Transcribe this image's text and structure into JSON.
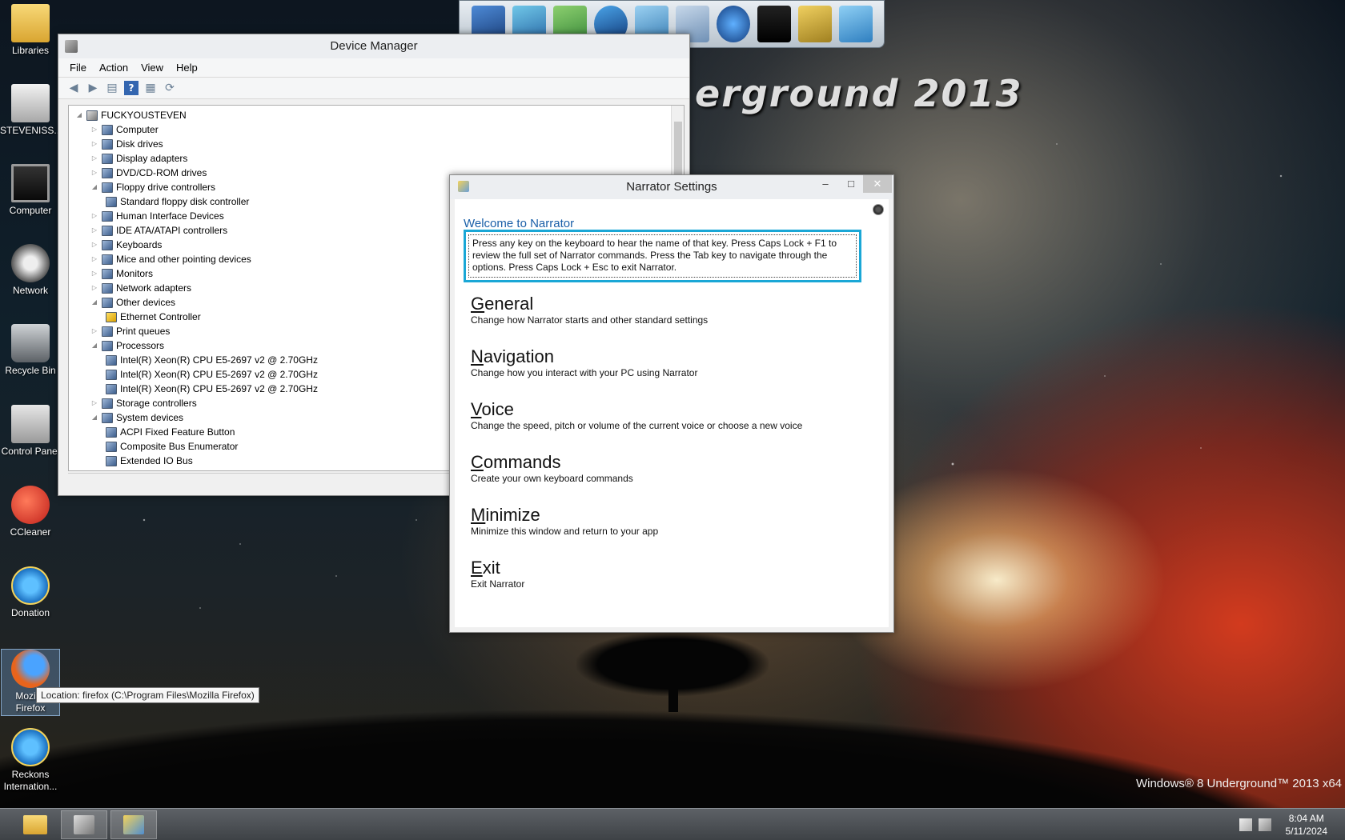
{
  "wallpaper": {
    "title": "erground 2013",
    "watermark": "Windows® 8 Underground™ 2013 x64"
  },
  "desktop_icons": [
    {
      "label": "Libraries",
      "icon": "folder-icon"
    },
    {
      "label": "STEVENISS...",
      "icon": "drive-icon"
    },
    {
      "label": "Computer",
      "icon": "monitor-icon"
    },
    {
      "label": "Network",
      "icon": "network-icon"
    },
    {
      "label": "Recycle Bin",
      "icon": "recycle-bin-icon"
    },
    {
      "label": "Control Panel",
      "icon": "control-panel-icon"
    },
    {
      "label": "CCleaner",
      "icon": "ccleaner-icon"
    },
    {
      "label": "Donation",
      "icon": "internet-explorer-icon"
    },
    {
      "label": "Mozilla Firefox",
      "icon": "firefox-icon"
    },
    {
      "label": "Reckons Internation...",
      "icon": "internet-explorer-icon"
    }
  ],
  "firefox_tooltip": "Location: firefox (C:\\Program Files\\Mozilla Firefox)",
  "device_manager": {
    "title": "Device Manager",
    "menu": [
      "File",
      "Action",
      "View",
      "Help"
    ],
    "tree": [
      {
        "label": "FUCKYOUSTEVEN",
        "level": 0,
        "expanded": true
      },
      {
        "label": "Computer",
        "level": 1,
        "expanded": false
      },
      {
        "label": "Disk drives",
        "level": 1,
        "expanded": false
      },
      {
        "label": "Display adapters",
        "level": 1,
        "expanded": false
      },
      {
        "label": "DVD/CD-ROM drives",
        "level": 1,
        "expanded": false
      },
      {
        "label": "Floppy drive controllers",
        "level": 1,
        "expanded": true
      },
      {
        "label": "Standard floppy disk controller",
        "level": 2
      },
      {
        "label": "Human Interface Devices",
        "level": 1,
        "expanded": false
      },
      {
        "label": "IDE ATA/ATAPI controllers",
        "level": 1,
        "expanded": false
      },
      {
        "label": "Keyboards",
        "level": 1,
        "expanded": false
      },
      {
        "label": "Mice and other pointing devices",
        "level": 1,
        "expanded": false
      },
      {
        "label": "Monitors",
        "level": 1,
        "expanded": false
      },
      {
        "label": "Network adapters",
        "level": 1,
        "expanded": false
      },
      {
        "label": "Other devices",
        "level": 1,
        "expanded": true
      },
      {
        "label": "Ethernet Controller",
        "level": 2,
        "warning": true
      },
      {
        "label": "Print queues",
        "level": 1,
        "expanded": false
      },
      {
        "label": "Processors",
        "level": 1,
        "expanded": true
      },
      {
        "label": "Intel(R) Xeon(R) CPU E5-2697 v2 @ 2.70GHz",
        "level": 2
      },
      {
        "label": "Intel(R) Xeon(R) CPU E5-2697 v2 @ 2.70GHz",
        "level": 2
      },
      {
        "label": "Intel(R) Xeon(R) CPU E5-2697 v2 @ 2.70GHz",
        "level": 2
      },
      {
        "label": "Storage controllers",
        "level": 1,
        "expanded": false
      },
      {
        "label": "System devices",
        "level": 1,
        "expanded": true
      },
      {
        "label": "ACPI Fixed Feature Button",
        "level": 2
      },
      {
        "label": "Composite Bus Enumerator",
        "level": 2
      },
      {
        "label": "Extended IO Bus",
        "level": 2
      }
    ]
  },
  "narrator": {
    "title": "Narrator Settings",
    "welcome": "Welcome to Narrator",
    "description": "Press any key on the keyboard to hear the name of that key.  Press Caps Lock + F1 to review the full set of Narrator commands.  Press the Tab key to navigate through the options.  Press Caps Lock + Esc to exit Narrator.",
    "options": [
      {
        "first": "G",
        "rest": "eneral",
        "desc": "Change how Narrator starts and other standard settings"
      },
      {
        "first": "N",
        "rest": "avigation",
        "desc": "Change how you interact with your PC using Narrator"
      },
      {
        "first": "V",
        "rest": "oice",
        "desc": "Change the speed, pitch or volume of the current voice or choose a new voice"
      },
      {
        "first": "C",
        "rest": "ommands",
        "desc": "Create your own keyboard commands"
      },
      {
        "first": "M",
        "rest": "inimize",
        "desc": "Minimize this window and return to your app"
      },
      {
        "first": "E",
        "rest": "xit",
        "desc": "Exit Narrator"
      }
    ]
  },
  "taskbar": {
    "time": "8:04 AM",
    "date": "5/11/2024"
  },
  "colors": {
    "accent": "#1aa7d6",
    "link_blue": "#1a5fa8"
  }
}
